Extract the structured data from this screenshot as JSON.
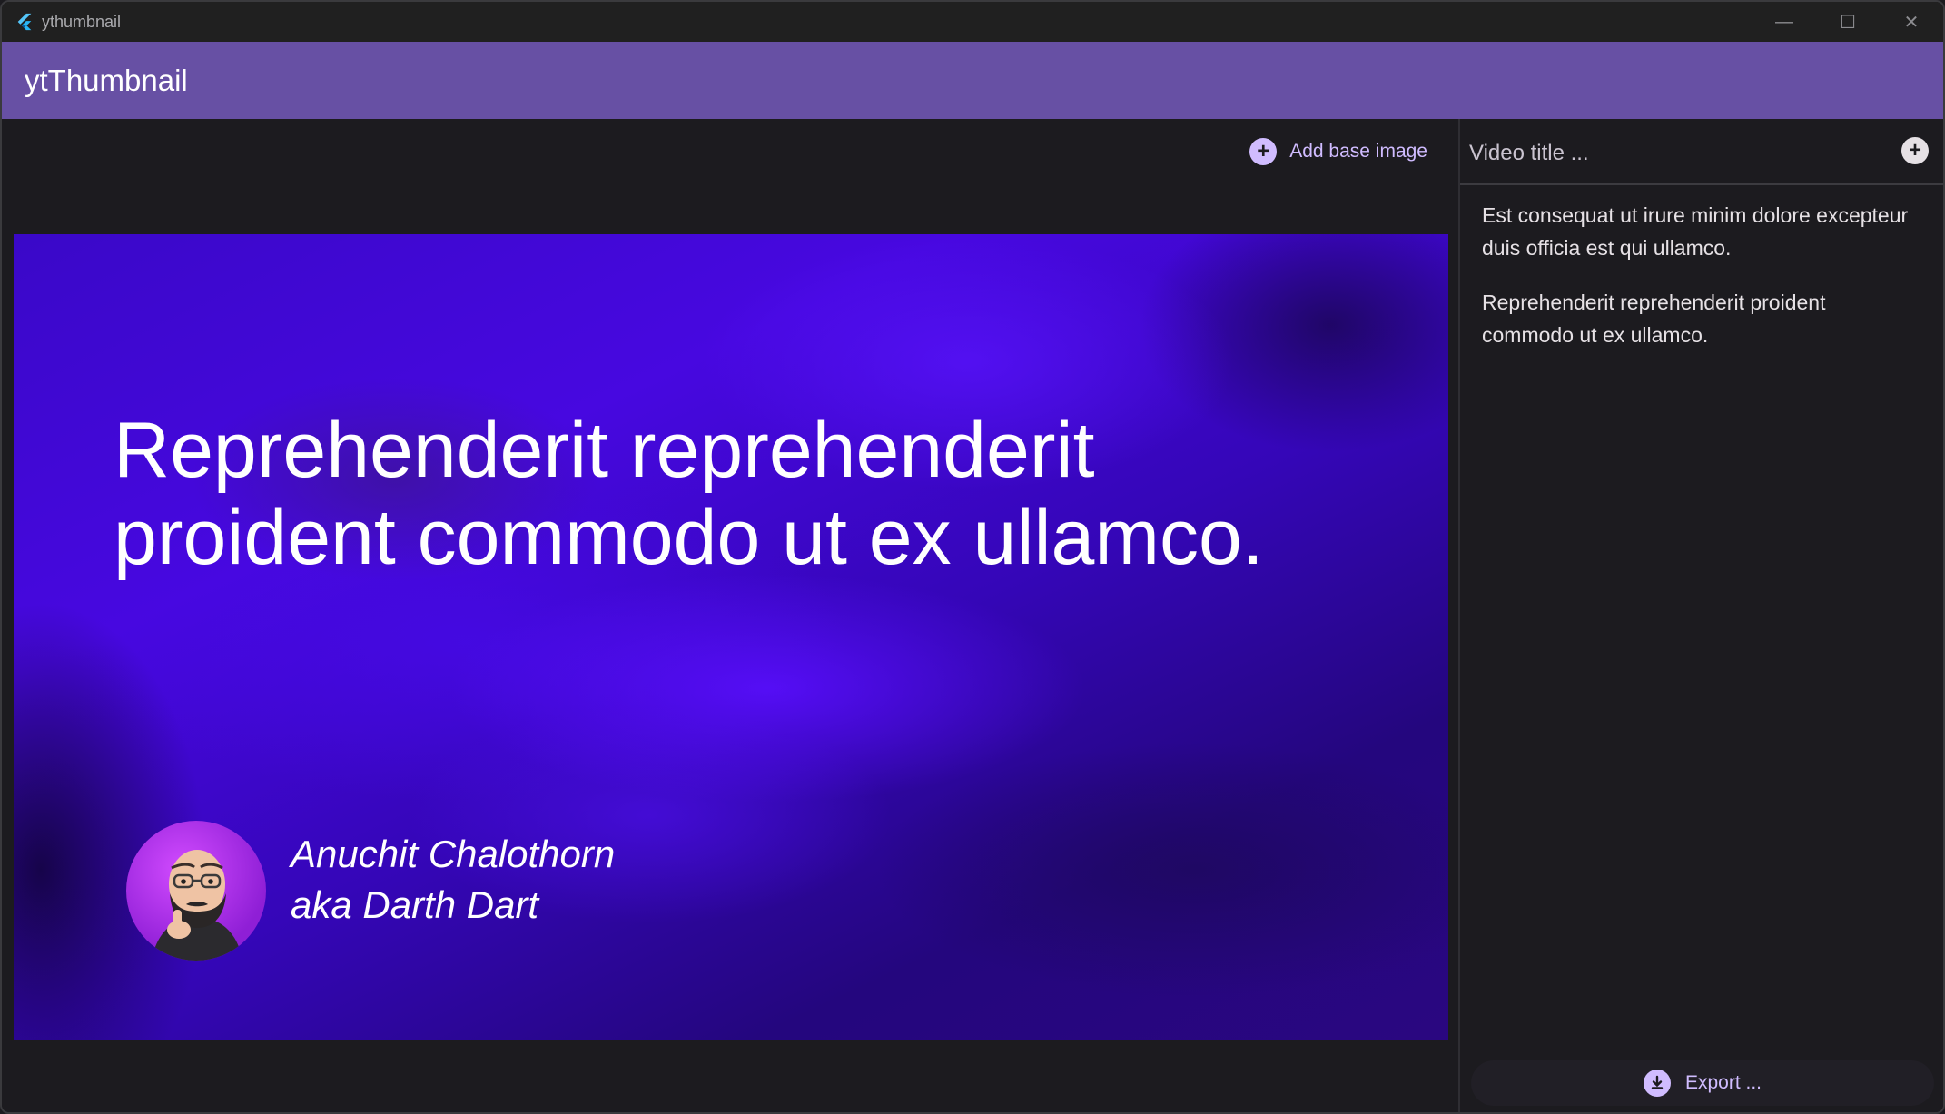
{
  "window": {
    "title": "ythumbnail",
    "controls": {
      "minimize": "—",
      "maximize": "☐",
      "close": "✕"
    }
  },
  "appbar": {
    "title": "ytThumbnail"
  },
  "colors": {
    "primary": "#6750a4",
    "accent": "#d0bcff",
    "background": "#1c1b1f"
  },
  "toolbar": {
    "add_base_image_label": "Add base image",
    "add_base_image_icon": "plus-circle-icon"
  },
  "thumbnail": {
    "headline": "Reprehenderit reprehenderit proident commodo ut ex ullamco.",
    "author_line1": "Anuchit Chalothorn",
    "author_line2": "aka Darth Dart",
    "avatar_icon": "person-avatar"
  },
  "sidebar": {
    "title_placeholder": "Video title ...",
    "title_value": "",
    "add_title_icon": "plus-circle-icon",
    "titles": [
      "Est consequat ut irure minim dolore excepteur duis officia est qui ullamco.",
      "Reprehenderit reprehenderit proident commodo ut ex ullamco."
    ],
    "export_label": "Export ...",
    "export_icon": "download-icon"
  }
}
